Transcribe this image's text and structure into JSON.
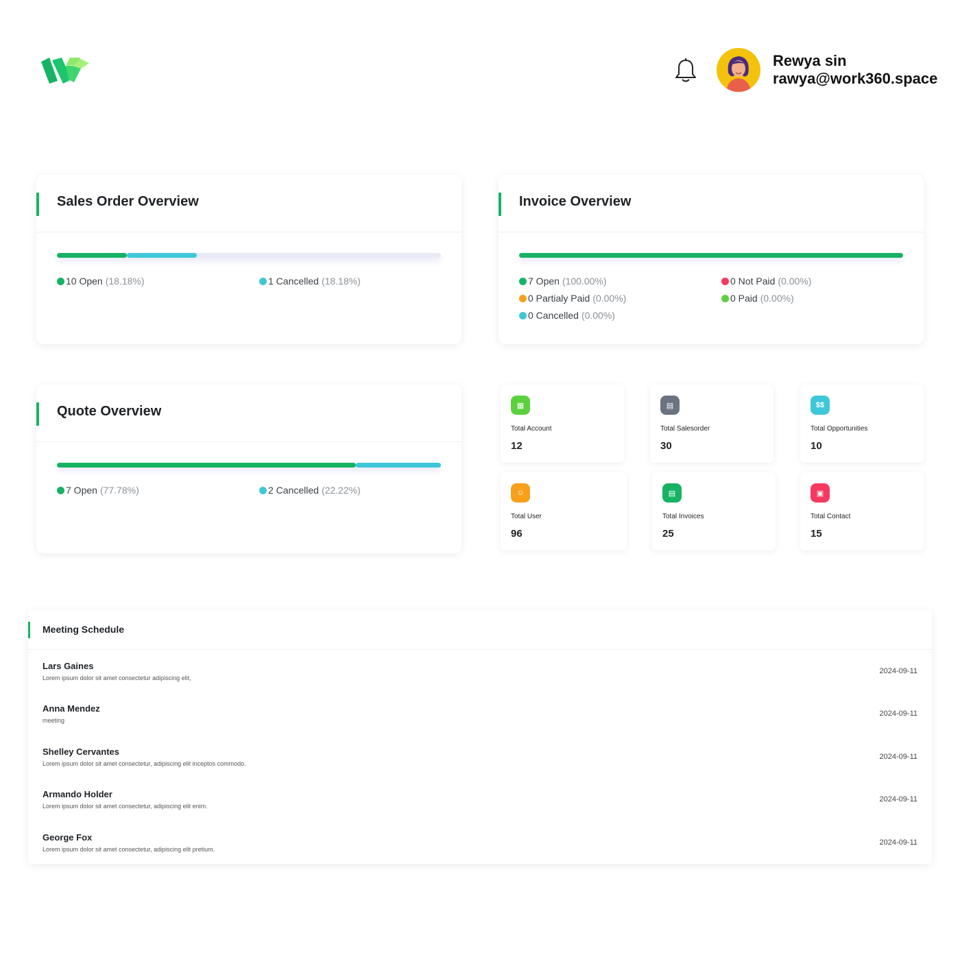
{
  "user": {
    "name": "Rewya sin",
    "email": "rawya@work360.space"
  },
  "colors": {
    "accent": "#16b364",
    "open": "#16b364",
    "cancelled": "#3ec7d8",
    "not_paid": "#f5395f",
    "partialy_paid": "#f7a01c",
    "paid": "#5bd13f",
    "track": "#e8eaf6"
  },
  "sales_order": {
    "title": "Sales Order Overview",
    "open_label": "10 Open",
    "open_pct": "(18.18%)",
    "cancelled_label": "1 Cancelled",
    "cancelled_pct": "(18.18%)",
    "open_share": 0.1818,
    "cancelled_share": 0.1818
  },
  "invoice": {
    "title": "Invoice Overview",
    "open_label": "7 Open",
    "open_pct": "(100.00%)",
    "not_paid_label": "0 Not Paid",
    "not_paid_pct": "(0.00%)",
    "partialy_paid_label": "0 Partialy Paid",
    "partialy_paid_pct": "(0.00%)",
    "paid_label": "0 Paid",
    "paid_pct": "(0.00%)",
    "cancelled_label": "0 Cancelled",
    "cancelled_pct": "(0.00%)",
    "open_share": 1.0
  },
  "quote": {
    "title": "Quote Overview",
    "open_label": "7 Open",
    "open_pct": "(77.78%)",
    "cancelled_label": "2 Cancelled",
    "cancelled_pct": "(22.22%)",
    "open_share": 0.7778,
    "cancelled_share": 0.2222
  },
  "stats": [
    {
      "label": "Total Account",
      "value": "12",
      "icon": "building-icon",
      "color": "#5bd13f"
    },
    {
      "label": "Total Salesorder",
      "value": "30",
      "icon": "document-icon",
      "color": "#6b7280"
    },
    {
      "label": "Total Opportunities",
      "value": "10",
      "icon": "dollar-icon",
      "color": "#3ec7d8"
    },
    {
      "label": "Total User",
      "value": "96",
      "icon": "user-icon",
      "color": "#f7a01c"
    },
    {
      "label": "Total Invoices",
      "value": "25",
      "icon": "invoice-icon",
      "color": "#16b364"
    },
    {
      "label": "Total Contact",
      "value": "15",
      "icon": "contact-icon",
      "color": "#f5395f"
    }
  ],
  "meeting": {
    "title": "Meeting Schedule",
    "rows": [
      {
        "name": "Lars Gaines",
        "desc": "Lorem ipsum dolor sit amet consectetur adipiscing elit,",
        "date": "2024-09-11"
      },
      {
        "name": "Anna Mendez",
        "desc": "meeting",
        "date": "2024-09-11"
      },
      {
        "name": "Shelley Cervantes",
        "desc": "Lorem ipsum dolor sit amet consectetur, adipiscing elit inceptos commodo.",
        "date": "2024-09-11"
      },
      {
        "name": "Armando Holder",
        "desc": "Lorem ipsum dolor sit amet consectetur, adipiscing elit enim.",
        "date": "2024-09-11"
      },
      {
        "name": "George Fox",
        "desc": "Lorem ipsum dolor sit amet consectetur, adipiscing elit pretium.",
        "date": "2024-09-11"
      }
    ]
  }
}
